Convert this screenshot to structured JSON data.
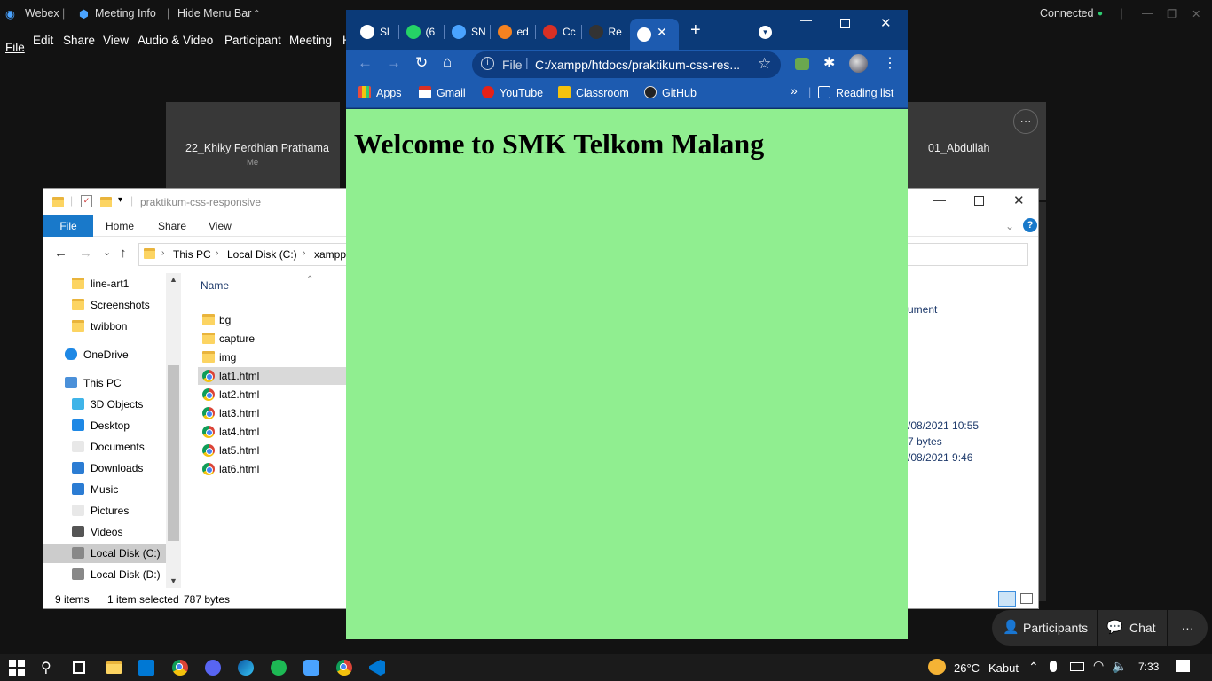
{
  "webex_topbar": {
    "app": "Webex",
    "meeting_info": "Meeting Info",
    "hide_menu": "Hide Menu Bar",
    "status": "Connected"
  },
  "webex_menu": [
    "File",
    "Edit",
    "Share",
    "View",
    "Audio & Video",
    "Participant",
    "Meeting",
    "H"
  ],
  "participants": {
    "tile1_name": "22_Khiky Ferdhian Prathama",
    "tile1_sub": "Me",
    "tile2_name": "01_Abdullah",
    "more": "···"
  },
  "explorer": {
    "title": "praktikum-css-responsive",
    "ribbon_tabs": {
      "file": "File",
      "home": "Home",
      "share": "Share",
      "view": "View"
    },
    "breadcrumb": [
      "This PC",
      "Local Disk (C:)",
      "xampp"
    ],
    "search_placeholder": "ve",
    "column_name": "Name",
    "nav": [
      "line-art1",
      "Screenshots",
      "twibbon",
      "OneDrive",
      "This PC",
      "3D Objects",
      "Desktop",
      "Documents",
      "Downloads",
      "Music",
      "Pictures",
      "Videos",
      "Local Disk (C:)",
      "Local Disk (D:)"
    ],
    "files": [
      "bg",
      "capture",
      "img",
      "lat1.html",
      "lat2.html",
      "lat3.html",
      "lat4.html",
      "lat5.html",
      "lat6.html"
    ],
    "details": {
      "type_partial": "ument",
      "modified": "/08/2021 10:55",
      "size": "7 bytes",
      "created": "/08/2021 9:46"
    },
    "status": {
      "count": "9 items",
      "selected": "1 item selected",
      "size": "787 bytes"
    }
  },
  "chrome": {
    "tabs": [
      {
        "label": "Sl",
        "color": "#ffffff"
      },
      {
        "label": "(6",
        "color": "#25d366"
      },
      {
        "label": "SN",
        "color": "#4aa3ff"
      },
      {
        "label": "ed",
        "color": "#f58220"
      },
      {
        "label": "Cc",
        "color": "#d93025"
      },
      {
        "label": "Re",
        "color": "#333333"
      }
    ],
    "url_scheme": "File",
    "url": "C:/xampp/htdocs/praktikum-css-res...",
    "bookmarks": [
      "Apps",
      "Gmail",
      "YouTube",
      "Classroom",
      "GitHub"
    ],
    "reading_list": "Reading list",
    "page_heading": "Welcome to SMK Telkom Malang"
  },
  "webex_bottom": {
    "participants": "Participants",
    "chat": "Chat",
    "more": "···"
  },
  "taskbar": {
    "weather": "26°C",
    "weather_desc": "Kabut",
    "time": "7:33"
  }
}
